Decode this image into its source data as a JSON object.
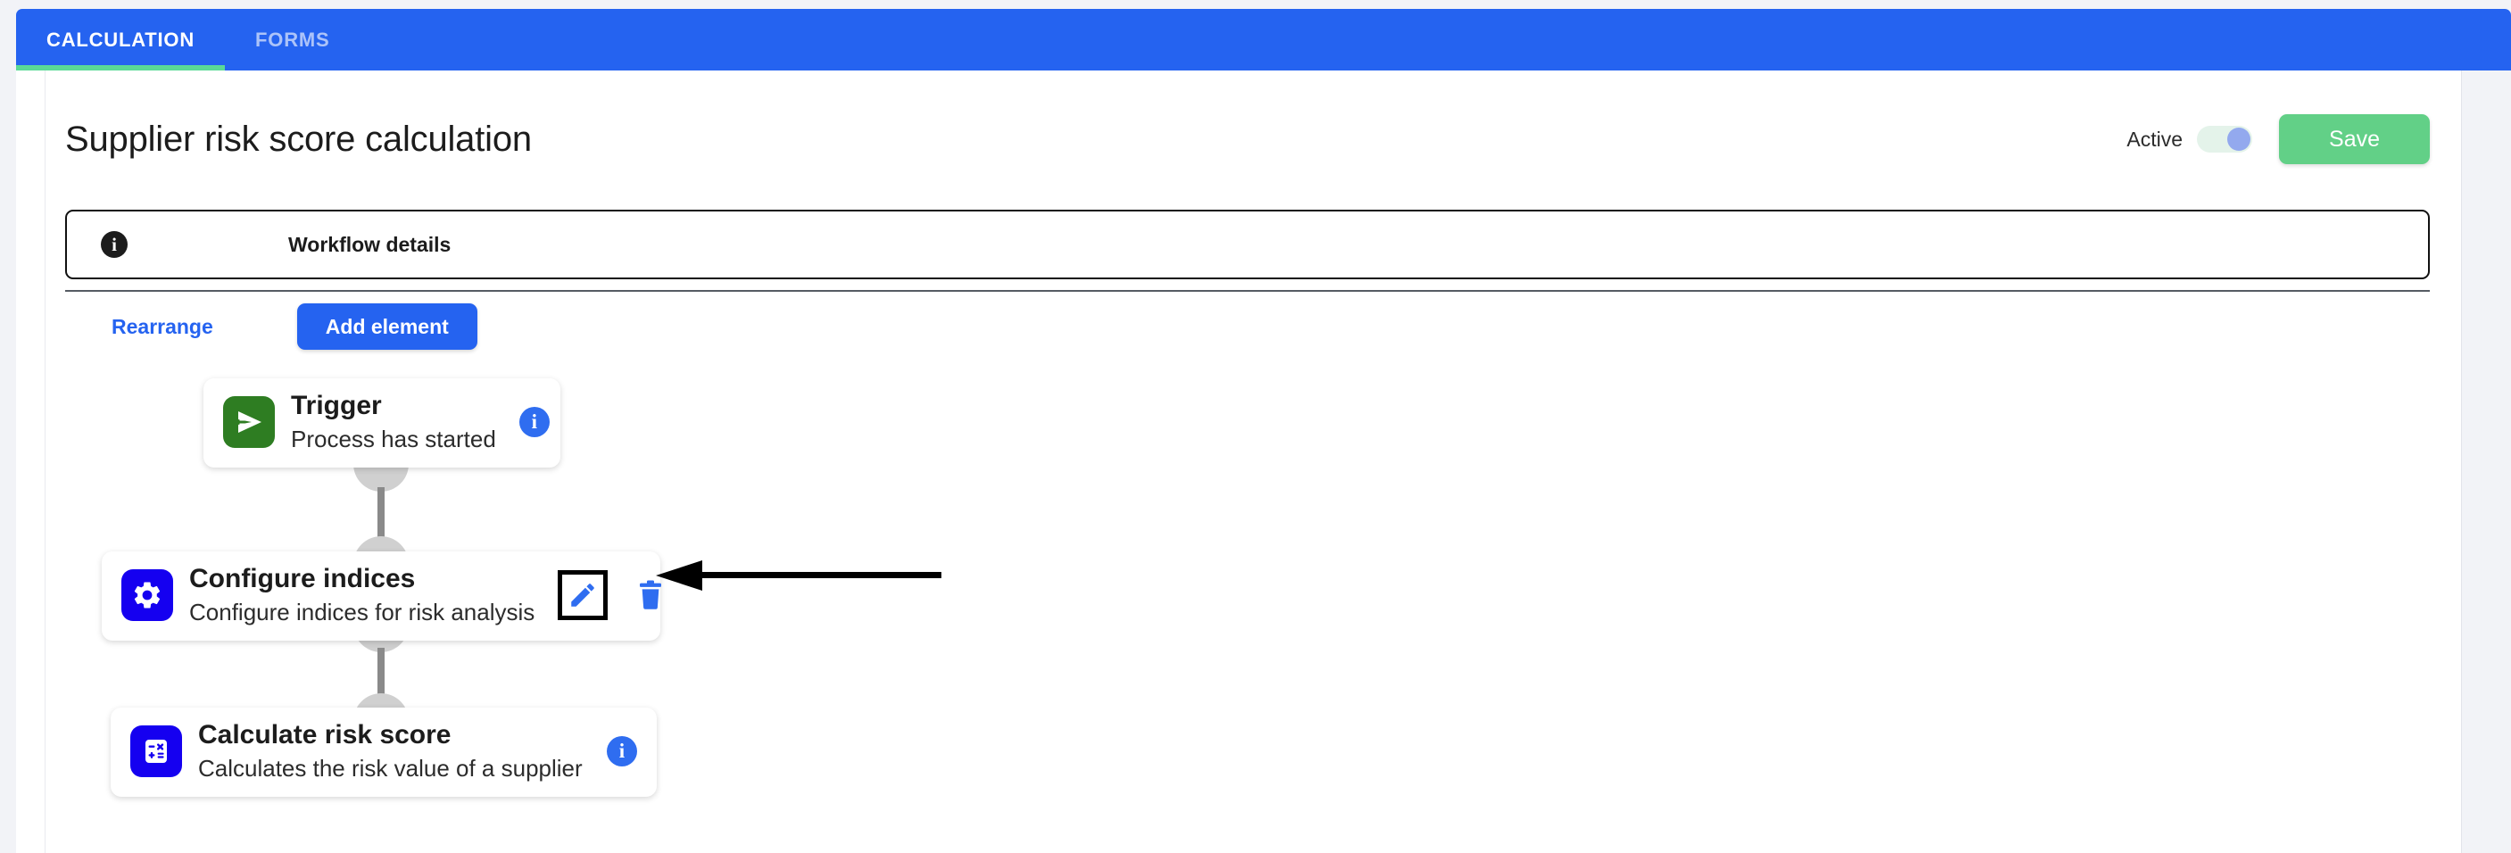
{
  "tabs": [
    {
      "label": "CALCULATION",
      "active": true
    },
    {
      "label": "FORMS",
      "active": false
    }
  ],
  "header": {
    "title": "Supplier risk score calculation",
    "active_label": "Active",
    "active_toggle_state": "on",
    "save_label": "Save"
  },
  "workflow_details": {
    "label": "Workflow details",
    "info_icon": "info-icon",
    "info_glyph": "i"
  },
  "actions": {
    "rearrange_label": "Rearrange",
    "add_element_label": "Add element"
  },
  "flow": {
    "nodes": [
      {
        "title": "Trigger",
        "subtitle": "Process has started",
        "icon": "send-arrow-icon",
        "icon_color": "#2e7d22",
        "right_control": "info-icon",
        "info_glyph": "i"
      },
      {
        "title": "Configure indices",
        "subtitle": "Configure indices for risk analysis",
        "icon": "gear-icon",
        "icon_color": "#1500f0",
        "right_control": "edit-delete",
        "edit_label": "edit-icon",
        "delete_label": "trash-icon"
      },
      {
        "title": "Calculate risk score",
        "subtitle": "Calculates the risk value of a supplier",
        "icon": "calculator-icon",
        "icon_color": "#1500f0",
        "right_control": "info-icon",
        "info_glyph": "i"
      }
    ]
  },
  "colors": {
    "tab_bar": "#2563f0",
    "tab_underline": "#5ad996",
    "primary_button": "#2563f0",
    "save_button": "#62d087",
    "page_background": "#f2f3f7",
    "toggle_knob": "#93a9ee",
    "toggle_track": "#e4f3ea",
    "annotation": "#000000"
  }
}
